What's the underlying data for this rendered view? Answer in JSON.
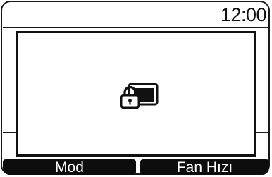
{
  "status_bar": {
    "time": "12:00"
  },
  "dialog": {
    "icon": "lock-screen-icon"
  },
  "softkeys": {
    "left_label": "Mod",
    "right_label": "Fan Hızı"
  },
  "colors": {
    "foreground": "#111111",
    "background": "#ffffff",
    "softkey_bg": "#0d0d0d",
    "softkey_text": "#ffffff"
  }
}
